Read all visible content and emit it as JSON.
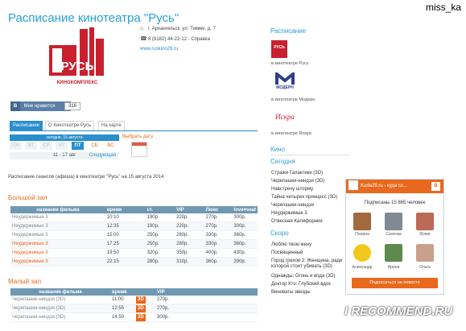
{
  "header": {
    "title": "Расписание кинотеатра \"Русь\"",
    "watermark_user": "miss_ka",
    "address": "г. Архангельск, ул. Тимме, д. 7",
    "phone": "8 (8182) 44-22-12 - Справка",
    "website": "www.ruskino29.ru"
  },
  "logo": {
    "brand": "РУСЬ",
    "subtitle": "КИНОКОМПЛЕКС"
  },
  "vk_like": {
    "label": "Мне нравится",
    "count": "316"
  },
  "tabs": [
    {
      "label": "Расписание",
      "active": true
    },
    {
      "label": "О Кинотеатре Русь",
      "active": false
    },
    {
      "label": "На карте",
      "active": false
    }
  ],
  "day_selector": {
    "header": "сегодня, 15 августа",
    "days": [
      {
        "label": "ПН",
        "state": "past"
      },
      {
        "label": "ВТ",
        "state": "past"
      },
      {
        "label": "СР",
        "state": "past"
      },
      {
        "label": "ЧТ",
        "state": "past"
      },
      {
        "label": "ПТ",
        "state": "today"
      },
      {
        "label": "СБ",
        "state": "weekend"
      },
      {
        "label": "ВС",
        "state": "weekend"
      }
    ],
    "range": "11 - 17 авг",
    "next": "Следующая",
    "choose_date": "Выбрать дату"
  },
  "schedule_desc": "Расписание сеансов (афиша) в кинотеатре \"Русь\" на 15 августа 2014",
  "big_hall": {
    "title": "Большой зал",
    "columns": [
      "название фильма",
      "время",
      "ст.",
      "VIP",
      "Люкс",
      "love♥seat"
    ],
    "rows": [
      {
        "film": "Неудержимые 3",
        "time": "10:10",
        "st": "190р.",
        "vip": "220р.",
        "lux": "270р.",
        "love": "300р.",
        "orange": false
      },
      {
        "film": "Неудержимые 3",
        "time": "12:35",
        "st": "190р.",
        "vip": "220р.",
        "lux": "270р.",
        "love": "300р.",
        "orange": false
      },
      {
        "film": "Неудержимые 3",
        "time": "15:00",
        "st": "250р.",
        "vip": "280р.",
        "lux": "330р.",
        "love": "360р.",
        "orange": false
      },
      {
        "film": "Неудержимые 3",
        "time": "17:25",
        "st": "250р.",
        "vip": "280р.",
        "lux": "330р.",
        "love": "360р.",
        "orange": true
      },
      {
        "film": "Неудержимые 3",
        "time": "19:50",
        "st": "320р.",
        "vip": "350р.",
        "lux": "400р.",
        "love": "430р.",
        "orange": true
      },
      {
        "film": "Неудержимые 3",
        "time": "22:15",
        "st": "280р.",
        "vip": "310р.",
        "lux": "360р.",
        "love": "390р.",
        "orange": true
      }
    ]
  },
  "small_hall": {
    "title": "Малый зал",
    "columns": [
      "название фильма",
      "время",
      "",
      "VIP"
    ],
    "rows": [
      {
        "film": "Черепашки-ниндзя (3D)",
        "time": "11:00",
        "badge": "3D",
        "vip": "270р."
      },
      {
        "film": "Черепашки-ниндзя (3D)",
        "time": "12:55",
        "badge": "3D",
        "vip": "270р."
      },
      {
        "film": "Черепашки-ниндзя (3D)",
        "time": "14:50",
        "badge": "3D",
        "vip": "300р."
      }
    ]
  },
  "right_col": {
    "schedule_heading": "Расписание",
    "cinemas": [
      {
        "label": "в кинотеатре Русь",
        "logo": "РУСЬ"
      },
      {
        "label": "в кинотеатре Модерн",
        "logo": "МОДЕРН"
      },
      {
        "label": "в кинотеатре Искра",
        "logo": "Искра"
      }
    ],
    "kino_heading": "Кино",
    "today_heading": "Сегодня",
    "today_films": [
      "Стражи Галактики (3D)",
      "Черепашки-ниндзя (3D)",
      "Навстречу шторму",
      "Тайна четырех принцесс (3D)",
      "Черепашки-ниндзя",
      "Неудержимые 3",
      "Отвесная Калифорния"
    ],
    "soon_heading": "Скоро",
    "soon_films": [
      "Люблю твою жену",
      "Посвященный",
      "Город грехов 2: Женщина, ради которой стоит убивать (3D)",
      "Однажды: Огонь и вода (3D)",
      "Доктор Кто: Глубокий вдох",
      "Виноваты звезды"
    ]
  },
  "vk_widget": {
    "title": "Kuda29.ru - куда сх...",
    "subscribers": "Подписаны 15 865 человек",
    "people": [
      "Полина",
      "Сенечка",
      "Юлия",
      "Александр",
      "Ирина",
      "Ольга"
    ],
    "subscribe_label": "Подписаться на новости"
  },
  "watermark": "I RECOMMEND.RU"
}
